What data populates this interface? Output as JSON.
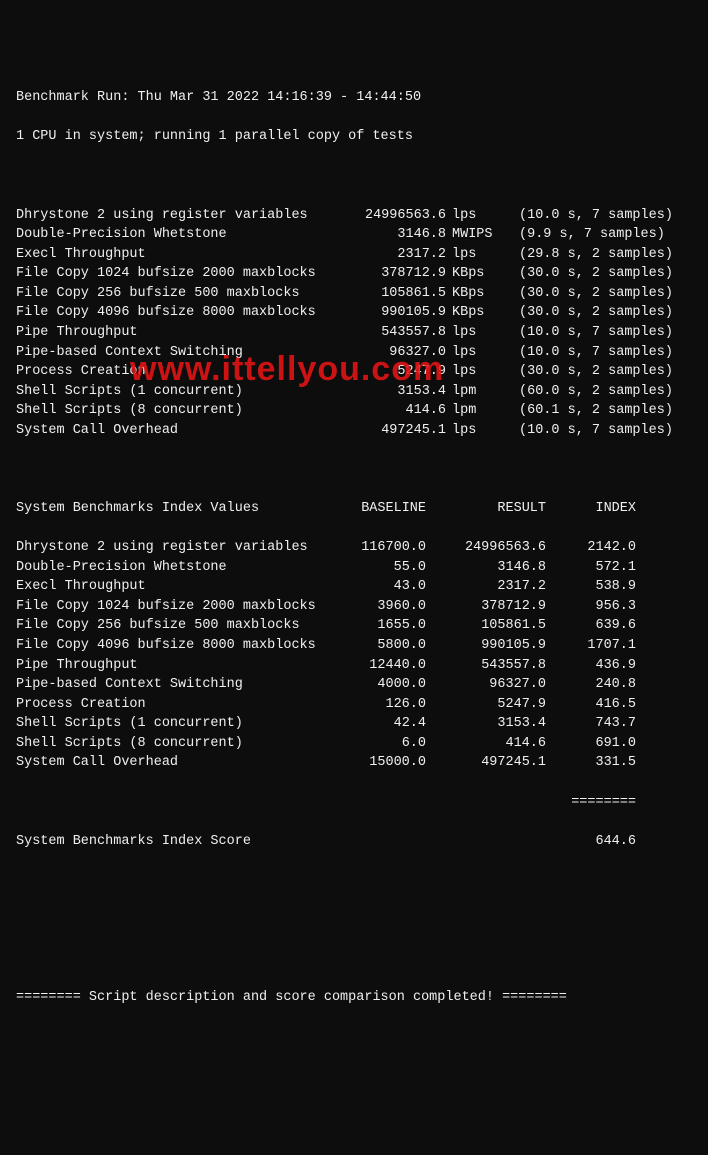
{
  "header": {
    "line1": "Benchmark Run: Thu Mar 31 2022 14:16:39 - 14:44:50",
    "line2": "1 CPU in system; running 1 parallel copy of tests"
  },
  "watermark": "www.ittellyou.com",
  "tests": [
    {
      "name": "Dhrystone 2 using register variables",
      "value": "24996563.6",
      "unit": "lps",
      "detail": "(10.0 s, 7 samples)"
    },
    {
      "name": "Double-Precision Whetstone",
      "value": "3146.8",
      "unit": "MWIPS",
      "detail": "(9.9 s, 7 samples)"
    },
    {
      "name": "Execl Throughput",
      "value": "2317.2",
      "unit": "lps",
      "detail": "(29.8 s, 2 samples)"
    },
    {
      "name": "File Copy 1024 bufsize 2000 maxblocks",
      "value": "378712.9",
      "unit": "KBps",
      "detail": "(30.0 s, 2 samples)"
    },
    {
      "name": "File Copy 256 bufsize 500 maxblocks",
      "value": "105861.5",
      "unit": "KBps",
      "detail": "(30.0 s, 2 samples)"
    },
    {
      "name": "File Copy 4096 bufsize 8000 maxblocks",
      "value": "990105.9",
      "unit": "KBps",
      "detail": "(30.0 s, 2 samples)"
    },
    {
      "name": "Pipe Throughput",
      "value": "543557.8",
      "unit": "lps",
      "detail": "(10.0 s, 7 samples)"
    },
    {
      "name": "Pipe-based Context Switching",
      "value": "96327.0",
      "unit": "lps",
      "detail": "(10.0 s, 7 samples)"
    },
    {
      "name": "Process Creation",
      "value": "5247.9",
      "unit": "lps",
      "detail": "(30.0 s, 2 samples)"
    },
    {
      "name": "Shell Scripts (1 concurrent)",
      "value": "3153.4",
      "unit": "lpm",
      "detail": "(60.0 s, 2 samples)"
    },
    {
      "name": "Shell Scripts (8 concurrent)",
      "value": "414.6",
      "unit": "lpm",
      "detail": "(60.1 s, 2 samples)"
    },
    {
      "name": "System Call Overhead",
      "value": "497245.1",
      "unit": "lps",
      "detail": "(10.0 s, 7 samples)"
    }
  ],
  "indexHeader": {
    "title": "System Benchmarks Index Values",
    "baseline": "BASELINE",
    "result": "RESULT",
    "index": "INDEX"
  },
  "index": [
    {
      "name": "Dhrystone 2 using register variables",
      "baseline": "116700.0",
      "result": "24996563.6",
      "index": "2142.0"
    },
    {
      "name": "Double-Precision Whetstone",
      "baseline": "55.0",
      "result": "3146.8",
      "index": "572.1"
    },
    {
      "name": "Execl Throughput",
      "baseline": "43.0",
      "result": "2317.2",
      "index": "538.9"
    },
    {
      "name": "File Copy 1024 bufsize 2000 maxblocks",
      "baseline": "3960.0",
      "result": "378712.9",
      "index": "956.3"
    },
    {
      "name": "File Copy 256 bufsize 500 maxblocks",
      "baseline": "1655.0",
      "result": "105861.5",
      "index": "639.6"
    },
    {
      "name": "File Copy 4096 bufsize 8000 maxblocks",
      "baseline": "5800.0",
      "result": "990105.9",
      "index": "1707.1"
    },
    {
      "name": "Pipe Throughput",
      "baseline": "12440.0",
      "result": "543557.8",
      "index": "436.9"
    },
    {
      "name": "Pipe-based Context Switching",
      "baseline": "4000.0",
      "result": "96327.0",
      "index": "240.8"
    },
    {
      "name": "Process Creation",
      "baseline": "126.0",
      "result": "5247.9",
      "index": "416.5"
    },
    {
      "name": "Shell Scripts (1 concurrent)",
      "baseline": "42.4",
      "result": "3153.4",
      "index": "743.7"
    },
    {
      "name": "Shell Scripts (8 concurrent)",
      "baseline": "6.0",
      "result": "414.6",
      "index": "691.0"
    },
    {
      "name": "System Call Overhead",
      "baseline": "15000.0",
      "result": "497245.1",
      "index": "331.5"
    }
  ],
  "separator": "========",
  "score": {
    "label": "System Benchmarks Index Score",
    "value": "644.6"
  },
  "footer": "======== Script description and score comparison completed! ========"
}
